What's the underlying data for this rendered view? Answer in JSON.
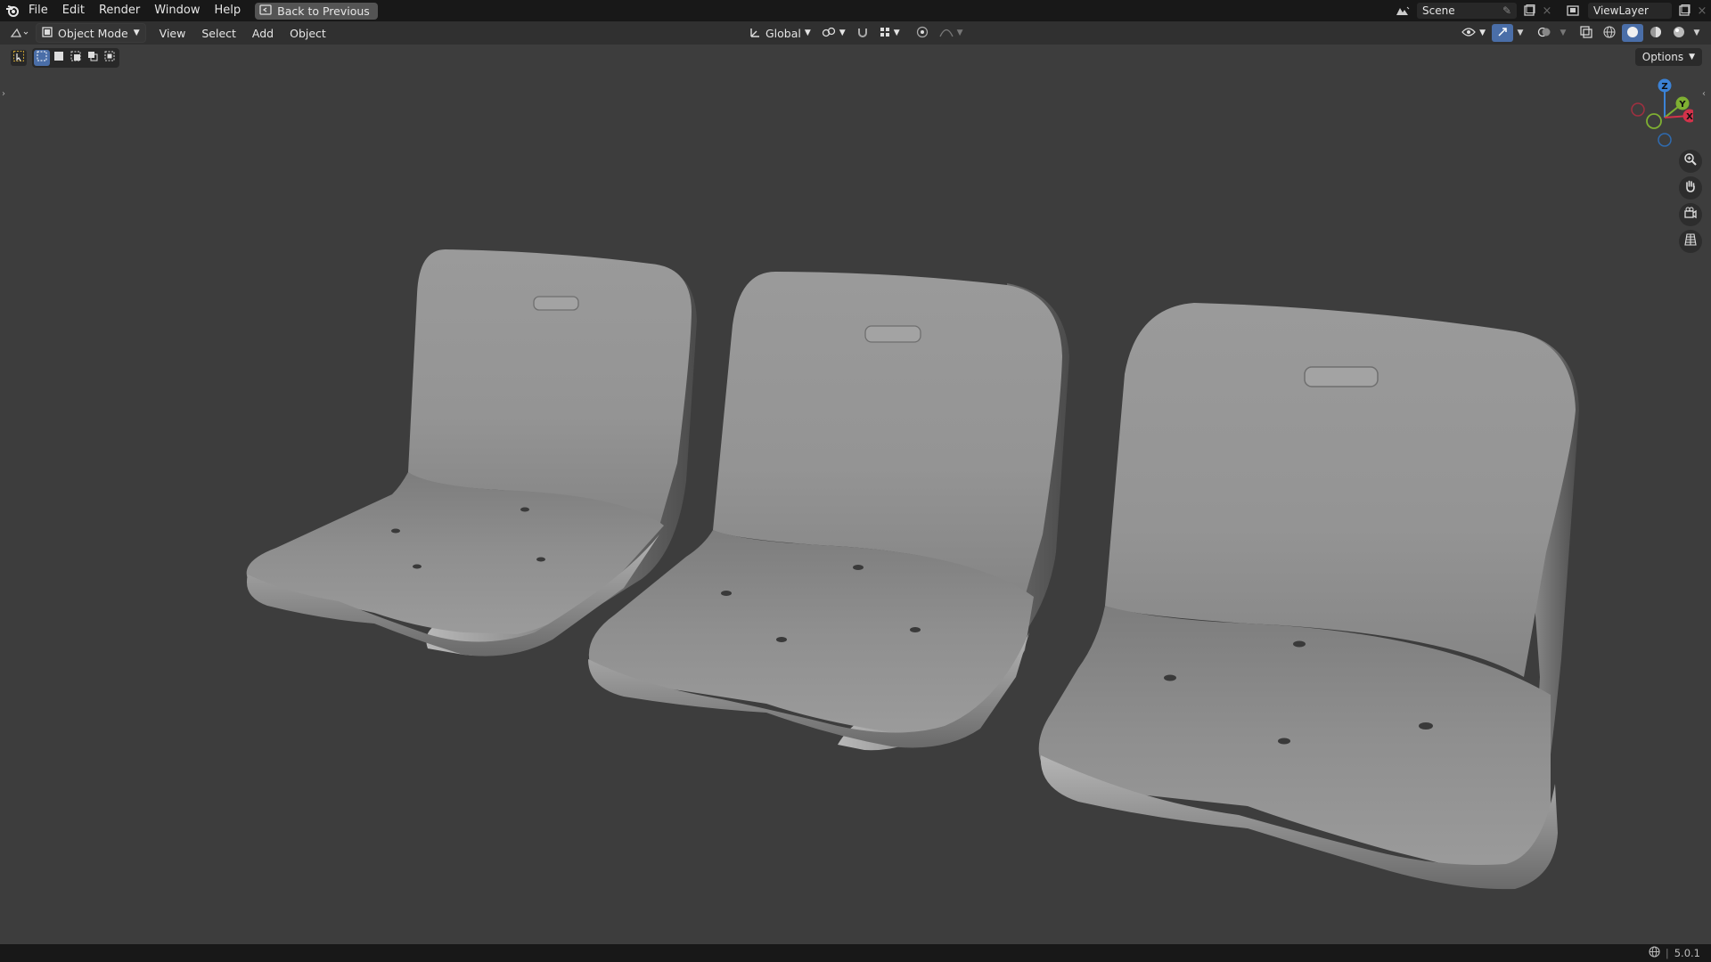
{
  "topbar": {
    "menus": [
      "File",
      "Edit",
      "Render",
      "Window",
      "Help"
    ],
    "back_label": "Back to Previous",
    "scene_name": "Scene",
    "view_layer_name": "ViewLayer"
  },
  "header": {
    "mode": "Object Mode",
    "menus": [
      "View",
      "Select",
      "Add",
      "Object"
    ],
    "transform_orientation": "Global"
  },
  "viewport": {
    "options_label": "Options",
    "gizmo_axes": [
      "X",
      "Y",
      "Z"
    ],
    "objects": [
      "seat-left",
      "seat-middle",
      "seat-right"
    ]
  },
  "statusbar": {
    "version": "5.0.1"
  },
  "colors": {
    "accent": "#4a6ea8",
    "viewport_bg": "#3d3d3d",
    "x_axis": "#d2324a",
    "y_axis": "#7fb032",
    "z_axis": "#3b82d6"
  }
}
